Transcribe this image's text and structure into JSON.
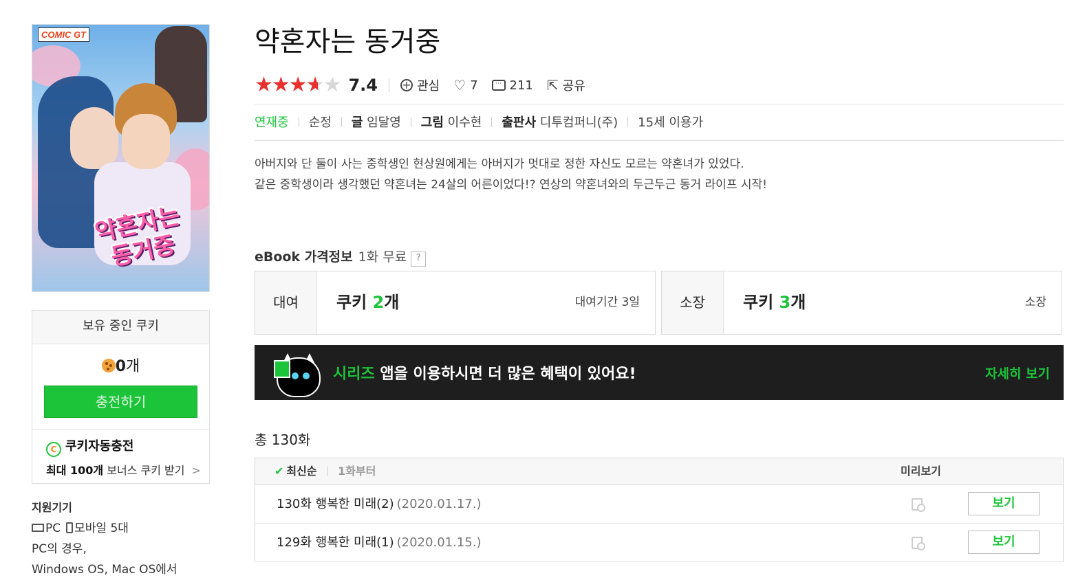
{
  "cover": {
    "badge_prefix": "",
    "badge_brand": "COMIC GT",
    "logo_line1": "약혼자는",
    "logo_line2": "동거중"
  },
  "title": "약혼자는 동거중",
  "rating": {
    "score": "7.4",
    "fill_fraction": 0.74
  },
  "actions": {
    "interest_label": "관심",
    "like_count": "7",
    "comment_count": "211",
    "share_label": "공유"
  },
  "meta": {
    "status": "연재중",
    "genre": "순정",
    "writer_label": "글",
    "writer": "임달영",
    "artist_label": "그림",
    "artist": "이수현",
    "publisher_label": "출판사",
    "publisher": "디투컴퍼니(주)",
    "age": "15세 이용가"
  },
  "description": [
    "아버지와 단 둘이 사는 중학생인 현상원에게는 아버지가 멋대로 정한 자신도 모르는 약혼녀가 있었다.",
    "같은 중학생이라 생각했던 약혼녀는 24살의 어른이었다!? 연상의 약혼녀와의 두근두근 동거 라이프 시작!"
  ],
  "price_info": {
    "title": "eBook 가격정보",
    "free": "1화 무료",
    "help": "?",
    "rent": {
      "label": "대여",
      "prefix": "쿠키 ",
      "amount": "2",
      "suffix": "개",
      "note": "대여기간 3일"
    },
    "own": {
      "label": "소장",
      "prefix": "쿠키 ",
      "amount": "3",
      "suffix": "개",
      "note": "소장"
    }
  },
  "banner": {
    "highlight": "시리즈",
    "text": " 앱을 이용하시면 더 많은 혜택이 있어요!",
    "more": "자세히 보기"
  },
  "cookie_box": {
    "header": "보유 중인 쿠키",
    "count": "0",
    "count_suffix": "개",
    "charge_button": "충전하기",
    "auto_icon": "C",
    "auto_title": "쿠키자동충전",
    "auto_bold": "최대 100개",
    "auto_rest": " 보너스 쿠키 받기",
    "arrow": ">"
  },
  "devices": {
    "title": "지원기기",
    "pc": "PC",
    "mobile": "모바일 5대",
    "note1": "PC의 경우,",
    "note2": "Windows OS, Mac OS에서"
  },
  "episodes": {
    "total": "총 130화",
    "sort_latest": "최신순",
    "sort_first": "1화부터",
    "preview_header": "미리보기",
    "items": [
      {
        "title": "130화 행복한 미래(2)",
        "date": "(2020.01.17.)",
        "button": "보기"
      },
      {
        "title": "129화 행복한 미래(1)",
        "date": "(2020.01.15.)",
        "button": "보기"
      }
    ]
  }
}
